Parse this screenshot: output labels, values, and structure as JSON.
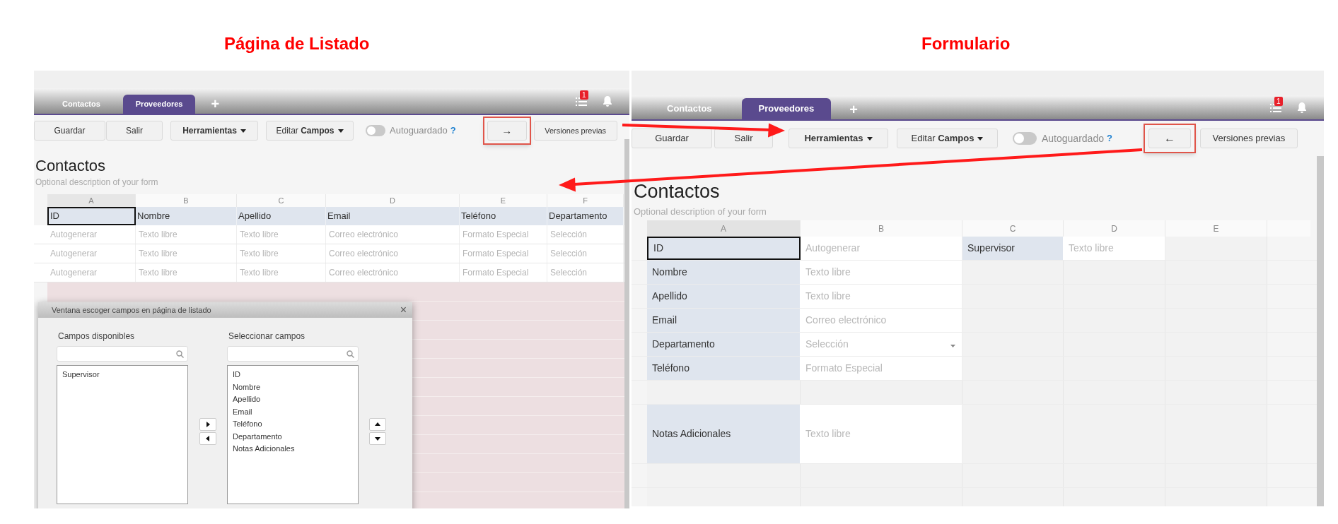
{
  "titles": [
    "Página de Listado",
    "Formulario"
  ],
  "listing_page": {
    "tabs": [
      {
        "label": "Contactos",
        "selected": false
      },
      {
        "label": "Proveedores",
        "selected": true
      }
    ],
    "add_tab": "+",
    "notification_count": "1",
    "toolbar": {
      "save": "Guardar",
      "exit": "Salir",
      "tools": "Herramientas",
      "edit_fields": "Editar **Campos**",
      "autosave": {
        "label": "Autoguardado",
        "on": false
      },
      "help": "?",
      "switch_button": "→",
      "versions": "Versiones previas"
    },
    "form_title": "Contactos",
    "description": "Optional description of your form",
    "columns": [
      "A",
      "B",
      "C",
      "D",
      "E",
      "F"
    ],
    "header_row": [
      {
        "text": "ID",
        "selected": true
      },
      {
        "text": "Nombre",
        "selected": false
      },
      {
        "text": "Apellido",
        "selected": false
      },
      {
        "text": "Email",
        "selected": false
      },
      {
        "text": "Teléfono",
        "selected": false
      },
      {
        "text": "Departamento",
        "selected": false
      }
    ],
    "rows": [
      [
        "Autogenerar",
        "Texto libre",
        "Texto libre",
        "Correo electrónico",
        "Formato Especial",
        "Selección"
      ],
      [
        "Autogenerar",
        "Texto libre",
        "Texto libre",
        "Correo electrónico",
        "Formato Especial",
        "Selección"
      ],
      [
        "Autogenerar",
        "Texto libre",
        "Texto libre",
        "Correo electrónico",
        "Formato Especial",
        "Selección"
      ]
    ],
    "dialog": {
      "title": "Ventana escoger campos en página de listado",
      "close": "×",
      "available": {
        "label": "Campos disponibles",
        "items": [
          "Supervisor"
        ]
      },
      "chosen": {
        "label": "Seleccionar campos",
        "items": [
          "ID",
          "Nombre",
          "Apellido",
          "Email",
          "Teléfono",
          "Departamento",
          "Notas Adicionales"
        ]
      }
    }
  },
  "form_page": {
    "tabs": [
      {
        "label": "Contactos",
        "selected": false
      },
      {
        "label": "Proveedores",
        "selected": true
      }
    ],
    "add_tab": "+",
    "notification_count": "1",
    "toolbar": {
      "save": "Guardar",
      "exit": "Salir",
      "tools": "Herramientas",
      "edit_fields": "Editar **Campos**",
      "autosave": {
        "label": "Autoguardado",
        "on": false
      },
      "help": "?",
      "switch_button": "←",
      "versions": "Versiones previas"
    },
    "form_title": "Contactos",
    "description": "Optional description of your form",
    "columns": [
      "A",
      "B",
      "C",
      "D",
      "E"
    ],
    "rows": [
      {
        "kind": "field",
        "cells": [
          {
            "kind": "label",
            "text": "ID",
            "selected": true
          },
          {
            "kind": "value",
            "text": "Autogenerar"
          },
          {
            "kind": "label",
            "text": "Supervisor",
            "selected": false
          },
          {
            "kind": "value",
            "text": "Texto libre"
          }
        ]
      },
      {
        "kind": "field",
        "cells": [
          {
            "kind": "label",
            "text": "Nombre",
            "selected": false
          },
          {
            "kind": "value",
            "text": "Texto libre"
          }
        ]
      },
      {
        "kind": "field",
        "cells": [
          {
            "kind": "label",
            "text": "Apellido",
            "selected": false
          },
          {
            "kind": "value",
            "text": "Texto libre"
          }
        ]
      },
      {
        "kind": "field",
        "cells": [
          {
            "kind": "label",
            "text": "Email",
            "selected": false
          },
          {
            "kind": "value",
            "text": "Correo electrónico"
          }
        ]
      },
      {
        "kind": "field",
        "cells": [
          {
            "kind": "label",
            "text": "Departamento",
            "selected": false
          },
          {
            "kind": "select",
            "text": "Selección"
          }
        ]
      },
      {
        "kind": "field",
        "cells": [
          {
            "kind": "label",
            "text": "Teléfono",
            "selected": false
          },
          {
            "kind": "value",
            "text": "Formato Especial"
          }
        ]
      },
      {
        "kind": "blank"
      },
      {
        "kind": "tall",
        "cells": [
          {
            "kind": "label",
            "text": "Notas Adicionales",
            "selected": false
          },
          {
            "kind": "value",
            "text": "Texto libre"
          }
        ]
      },
      {
        "kind": "blank"
      },
      {
        "kind": "blank"
      }
    ]
  }
}
